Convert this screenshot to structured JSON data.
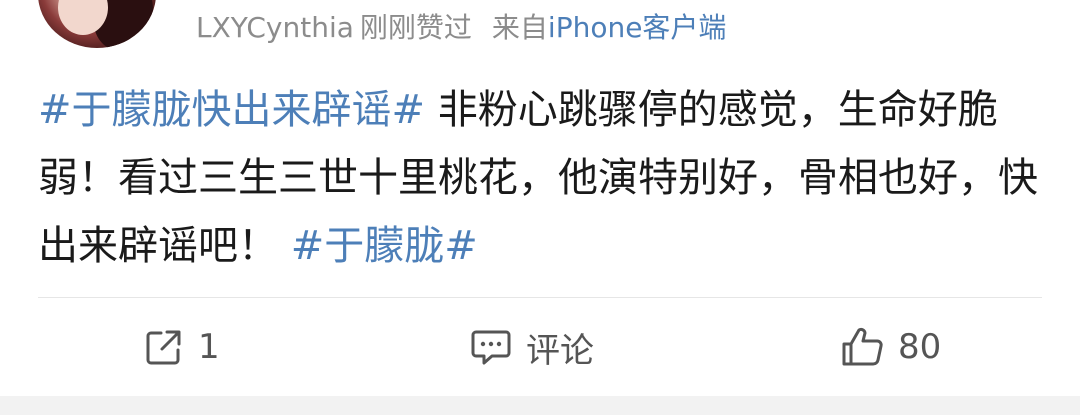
{
  "header": {
    "username": "LXYCynthia",
    "liked_status": "刚刚赞过",
    "from_prefix": "来自",
    "client": "iPhone客户端"
  },
  "post": {
    "topic1": "#于朦胧快出来辟谣#",
    "text1": " 非粉心跳骤停的感觉，生命好脆弱！看过三生三世十里桃花，他演特别好，骨相也好，快出来辟谣吧！",
    "topic2": "#于朦胧#"
  },
  "actions": {
    "repost_count": "1",
    "comment_label": "评论",
    "like_count": "80"
  },
  "colors": {
    "link": "#4d7fb8",
    "meta_gray": "#8c8c8c",
    "text": "#1a1a1a",
    "action_gray": "#555555"
  },
  "icons": {
    "repost": "share-arrow-box-icon",
    "comment": "speech-bubble-icon",
    "like": "thumbs-up-icon"
  }
}
